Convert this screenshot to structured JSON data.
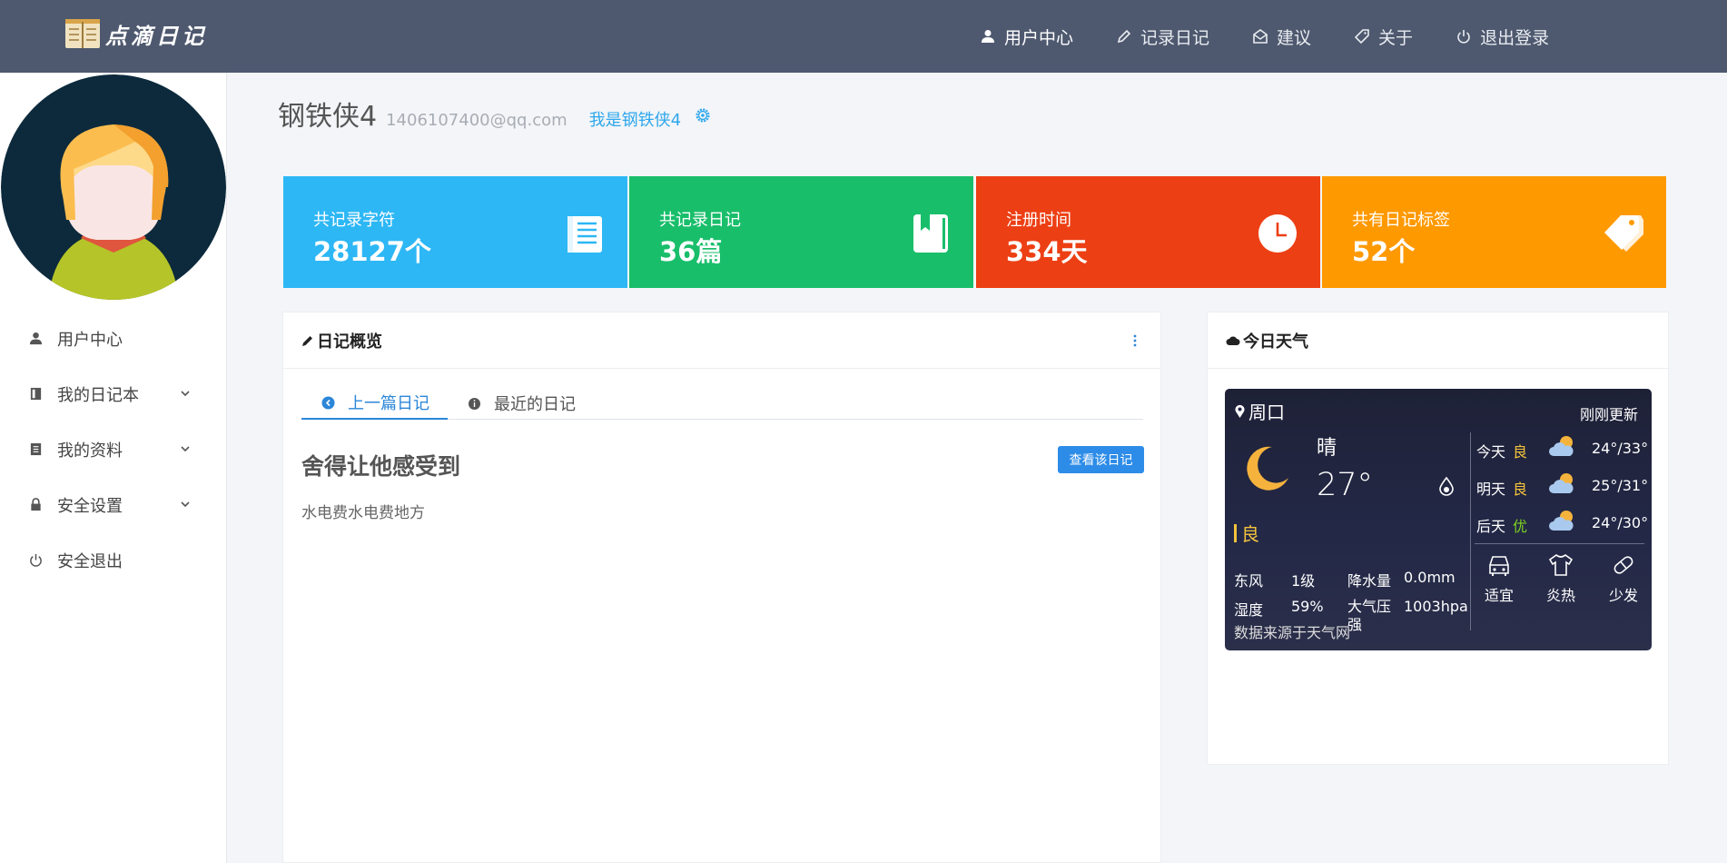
{
  "app": {
    "logo_text": "点滴日记"
  },
  "topnav": [
    {
      "label": "用户中心",
      "icon": "user-icon"
    },
    {
      "label": "记录日记",
      "icon": "pencil-icon"
    },
    {
      "label": "建议",
      "icon": "mail-icon"
    },
    {
      "label": "关于",
      "icon": "tag-icon"
    },
    {
      "label": "退出登录",
      "icon": "power-icon"
    }
  ],
  "sidebar": {
    "items": [
      {
        "label": "用户中心",
        "icon": "user-icon",
        "expandable": false
      },
      {
        "label": "我的日记本",
        "icon": "notebook-icon",
        "expandable": true
      },
      {
        "label": "我的资料",
        "icon": "document-icon",
        "expandable": true
      },
      {
        "label": "安全设置",
        "icon": "lock-icon",
        "expandable": true
      },
      {
        "label": "安全退出",
        "icon": "power-icon",
        "expandable": false
      }
    ]
  },
  "profile": {
    "name": "钢铁侠4",
    "email": "1406107400@qq.com",
    "motto": "我是钢铁侠4"
  },
  "stats": [
    {
      "label": "共记录字符",
      "value": "28127个",
      "color": "#2db7f5",
      "icon": "list-document-icon"
    },
    {
      "label": "共记录日记",
      "value": "36篇",
      "color": "#19be6b",
      "icon": "book-icon"
    },
    {
      "label": "注册时间",
      "value": "334天",
      "color": "#ed3f14",
      "icon": "clock-icon"
    },
    {
      "label": "共有日记标签",
      "value": "52个",
      "color": "#ff9900",
      "icon": "tags-icon"
    }
  ],
  "overview": {
    "title": "日记概览",
    "tabs": [
      {
        "label": "上一篇日记",
        "active": true
      },
      {
        "label": "最近的日记",
        "active": false
      }
    ],
    "diary_title": "舍得让他感受到",
    "view_button": "查看该日记",
    "diary_body": "水电费水电费地方"
  },
  "weather": {
    "panel_title": "今日天气",
    "city": "周口",
    "updated": "刚刚更新",
    "condition": "晴",
    "temperature": "27°",
    "aqi": "良",
    "wind_dir": "东风",
    "wind_level": "1级",
    "precip_label": "降水量",
    "precip_value": "0.0mm",
    "humidity_label": "湿度",
    "humidity_value": "59%",
    "pressure_label": "大气压强",
    "pressure_value": "1003hpa",
    "source": "数据来源于天气网",
    "forecast": [
      {
        "day": "今天",
        "aqi": "良",
        "aqi_color": "#f4c23c",
        "temp": "24°/33°"
      },
      {
        "day": "明天",
        "aqi": "良",
        "aqi_color": "#f4c23c",
        "temp": "25°/31°"
      },
      {
        "day": "后天",
        "aqi": "优",
        "aqi_color": "#7ed321",
        "temp": "24°/30°"
      }
    ],
    "life": [
      {
        "label": "适宜",
        "icon": "car-icon"
      },
      {
        "label": "炎热",
        "icon": "shirt-icon"
      },
      {
        "label": "少发",
        "icon": "pill-icon"
      }
    ]
  }
}
